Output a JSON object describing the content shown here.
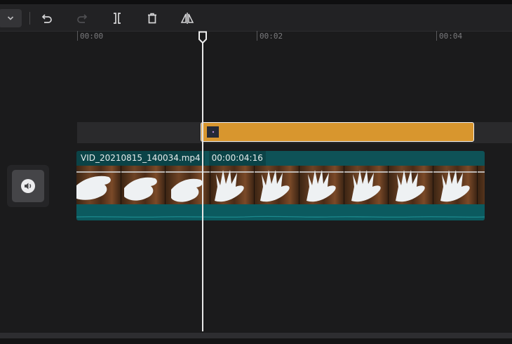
{
  "toolbar": {
    "dropdown_icon": "chevron-down-icon",
    "buttons": [
      {
        "name": "undo",
        "icon": "undo-icon",
        "enabled": true
      },
      {
        "name": "redo",
        "icon": "redo-icon",
        "enabled": false
      },
      {
        "name": "split",
        "icon": "split-icon",
        "enabled": true
      },
      {
        "name": "delete",
        "icon": "trash-icon",
        "enabled": true
      },
      {
        "name": "mirror",
        "icon": "flip-horizontal-icon",
        "enabled": true
      }
    ]
  },
  "ruler": {
    "ticks": [
      "00:00",
      "00:02",
      "00:04"
    ]
  },
  "timeline": {
    "text_clip": {
      "color": "#d8962e"
    },
    "video_clip": {
      "name": "VID_20210815_140034.mp4",
      "duration": "00:00:04:16",
      "color": "#0e5257"
    },
    "mute_button_icon": "volume-icon"
  }
}
